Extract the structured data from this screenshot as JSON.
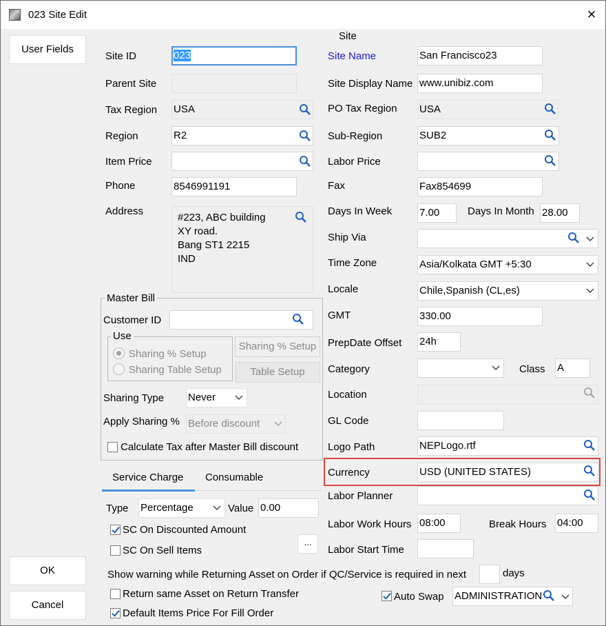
{
  "window": {
    "title": "023 Site Edit",
    "close_label": "×"
  },
  "side_buttons": {
    "user_fields": "User Fields",
    "ok": "OK",
    "cancel": "Cancel"
  },
  "section_title": "Site",
  "left": {
    "site_id": {
      "label": "Site ID",
      "value": "023"
    },
    "parent_site": {
      "label": "Parent Site",
      "value": ""
    },
    "tax_region": {
      "label": "Tax Region",
      "value": "USA"
    },
    "region": {
      "label": "Region",
      "value": "R2"
    },
    "item_price": {
      "label": "Item Price",
      "value": ""
    },
    "phone": {
      "label": "Phone",
      "value": "8546991191"
    },
    "address": {
      "label": "Address",
      "lines": [
        "#223, ABC building",
        "XY road.",
        "Bang ST1 2215",
        "IND"
      ]
    }
  },
  "master_bill": {
    "title": "Master Bill",
    "customer_id": {
      "label": "Customer ID",
      "value": ""
    },
    "use": {
      "title": "Use",
      "options": [
        "Sharing % Setup",
        "Sharing Table Setup"
      ],
      "selected": 0
    },
    "buttons": [
      "Sharing % Setup",
      "Table Setup"
    ],
    "sharing_type": {
      "label": "Sharing Type",
      "value": "Never"
    },
    "apply_sharing": {
      "label": "Apply Sharing %",
      "value": "Before discount"
    },
    "calc_tax": {
      "label": "Calculate Tax after Master Bill discount",
      "checked": false
    }
  },
  "tabs": {
    "items": [
      "Service Charge",
      "Consumable"
    ],
    "active": 0
  },
  "service_charge": {
    "type": {
      "label": "Type",
      "value": "Percentage"
    },
    "value": {
      "label": "Value",
      "value": "0.00"
    },
    "sc_discounted": {
      "label": "SC On Discounted Amount",
      "checked": true
    },
    "sc_sell": {
      "label": "SC On Sell Items",
      "checked": false
    },
    "ellipsis": "..."
  },
  "right": {
    "site_name": {
      "label": "Site Name",
      "value": "San Francisco23"
    },
    "site_display_name": {
      "label": "Site Display Name",
      "value": "www.unibiz.com"
    },
    "po_tax_region": {
      "label": "PO Tax Region",
      "value": "USA"
    },
    "sub_region": {
      "label": "Sub-Region",
      "value": "SUB2"
    },
    "labor_price": {
      "label": "Labor Price",
      "value": ""
    },
    "fax": {
      "label": "Fax",
      "value": "Fax854699"
    },
    "days_in_week": {
      "label": "Days In Week",
      "value": "7.00"
    },
    "days_in_month": {
      "label": "Days In Month",
      "value": "28.00"
    },
    "ship_via": {
      "label": "Ship Via",
      "value": ""
    },
    "time_zone": {
      "label": "Time Zone",
      "value": "Asia/Kolkata GMT +5:30"
    },
    "locale": {
      "label": "Locale",
      "value": "Chile,Spanish (CL,es)"
    },
    "gmt": {
      "label": "GMT",
      "value": "330.00"
    },
    "prepdate_offset": {
      "label": "PrepDate Offset",
      "value": "24h"
    },
    "category": {
      "label": "Category",
      "value": ""
    },
    "class": {
      "label": "Class",
      "value": "A"
    },
    "location": {
      "label": "Location",
      "value": ""
    },
    "gl_code": {
      "label": "GL Code",
      "value": ""
    },
    "logo_path": {
      "label": "Logo Path",
      "value": "NEPLogo.rtf"
    },
    "currency": {
      "label": "Currency",
      "value": "USD (UNITED STATES)"
    },
    "labor_planner": {
      "label": "Labor Planner",
      "value": ""
    },
    "labor_work_hours": {
      "label": "Labor Work Hours",
      "value": "08:00"
    },
    "break_hours": {
      "label": "Break Hours",
      "value": "04:00"
    },
    "labor_start_time": {
      "label": "Labor Start Time",
      "value": ""
    }
  },
  "bottom": {
    "warning_label": "Show warning while Returning Asset on Order if QC/Service is required in next",
    "warning_days_value": "",
    "days_label": "days",
    "return_same": {
      "label": "Return same Asset on Return Transfer",
      "checked": false
    },
    "default_items": {
      "label": "Default Items Price For Fill Order",
      "checked": true
    },
    "auto_swap": {
      "label": "Auto Swap",
      "checked": true
    },
    "auto_swap_value": "ADMINISTRATION"
  },
  "colors": {
    "accent": "#4a90d9",
    "highlight": "#d9483b",
    "required_label": "#1a1ad6",
    "lookup_icon": "#1f5fbf"
  }
}
